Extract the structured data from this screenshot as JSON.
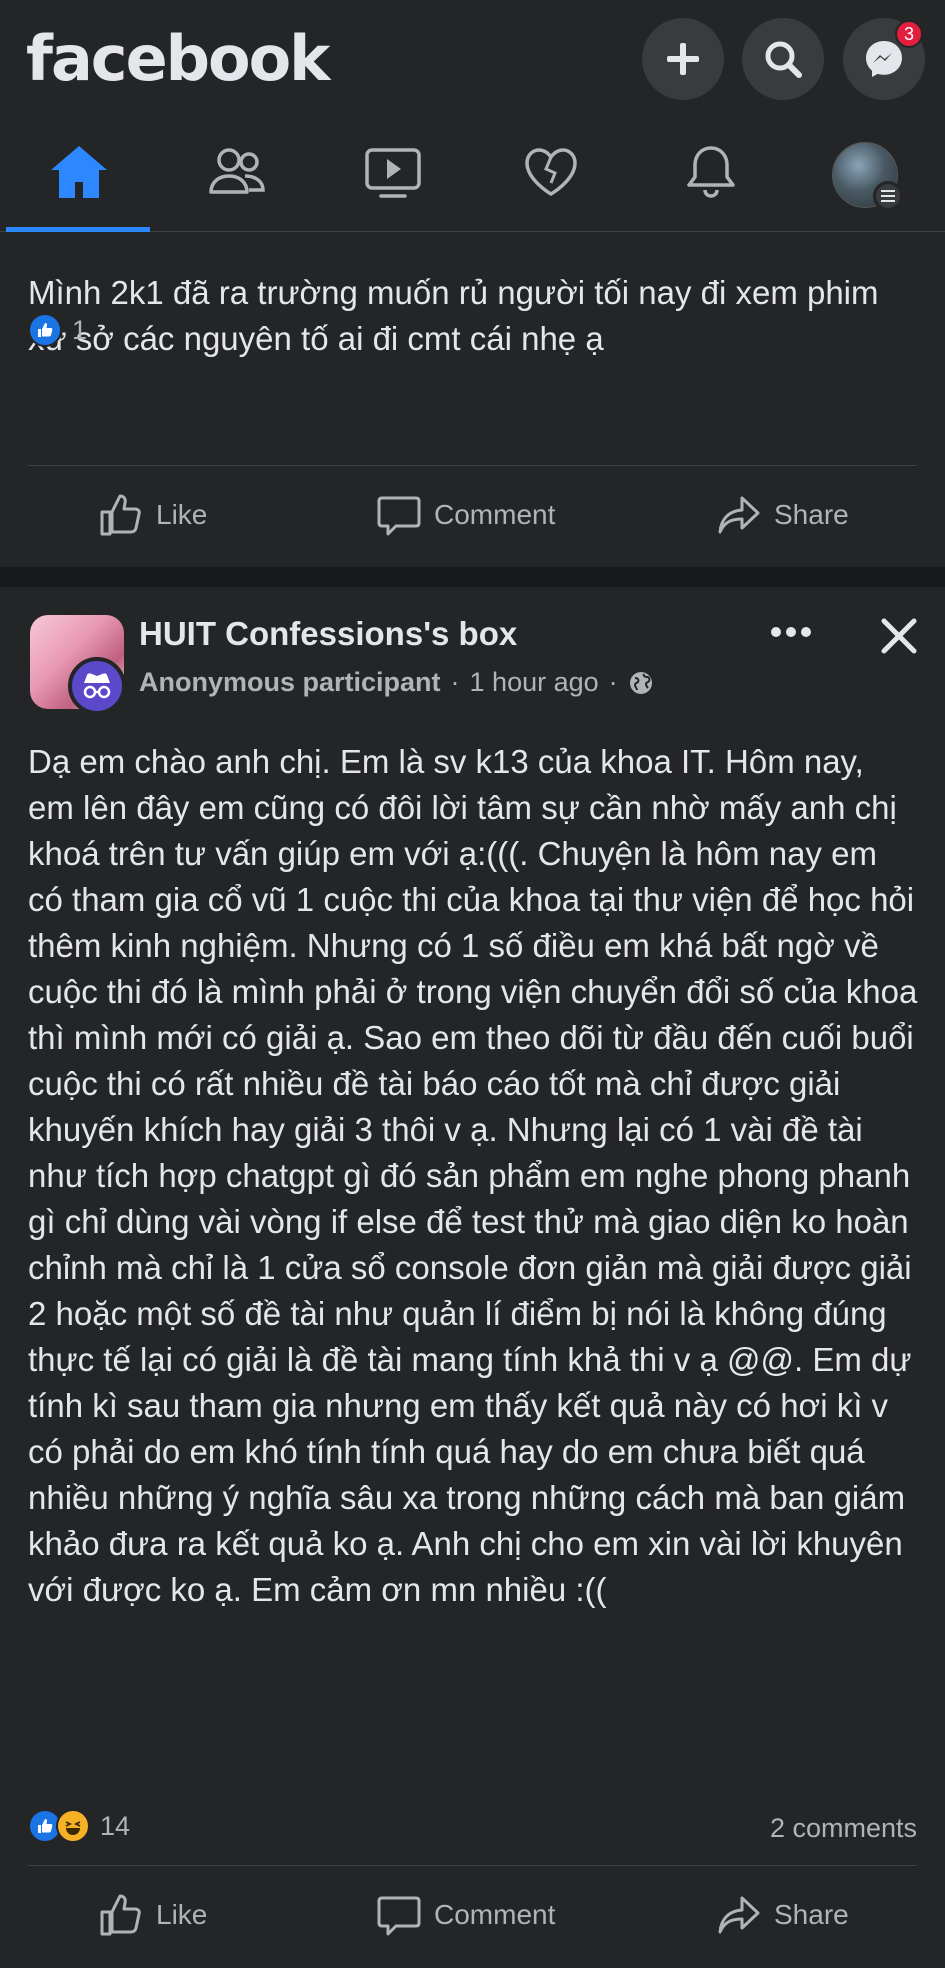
{
  "header": {
    "logo": "facebook",
    "messenger_badge": "3"
  },
  "nav": {
    "items": [
      "home",
      "friends",
      "watch",
      "dating",
      "notifications",
      "profile-menu"
    ],
    "active": "home"
  },
  "post1": {
    "text": "Mình 2k1 đã ra trường muốn rủ người tối nay đi xem phim xử sở các nguyên tố ai đi cmt cái nhẹ ạ",
    "reaction_count": "1",
    "actions": {
      "like": "Like",
      "comment": "Comment",
      "share": "Share"
    }
  },
  "post2": {
    "page_name": "HUIT Confessions's box",
    "author": "Anonymous participant",
    "time": "1 hour ago",
    "separator": "·",
    "text": "Dạ em chào anh chị. Em là sv k13 của khoa IT. Hôm nay, em lên đây em cũng có đôi lời tâm sự cần nhờ mấy anh chị khoá trên tư vấn giúp em với ạ:(((. Chuyện là hôm nay em có tham gia cổ vũ 1 cuộc thi của khoa tại thư viện để học hỏi thêm kinh nghiệm. Nhưng có 1 số điều em khá bất ngờ về cuộc thi đó là mình phải ở trong viện chuyển đổi số của khoa thì mình mới có giải ạ. Sao em theo dõi từ đầu đến cuối buổi cuộc thi có rất nhiều đề tài báo cáo tốt mà chỉ được giải khuyến khích hay giải 3 thôi v ạ. Nhưng lại có 1 vài đề tài như tích hợp chatgpt gì đó sản phẩm em nghe phong phanh gì chỉ dùng vài vòng if else để test thử mà giao diện ko hoàn chỉnh mà chỉ là 1 cửa sổ console đơn giản mà giải được giải 2 hoặc một số đề tài như quản lí điểm bị nói là không đúng thực tế lại có giải là đề tài mang tính khả thi v ạ @@. Em dự tính kì sau tham gia nhưng em thấy kết quả này có hơi kì v có phải do em khó tính tính quá hay do em chưa biết quá nhiều những ý nghĩa sâu xa trong những cách mà ban giám khảo đưa ra kết quả ko ạ. Anh chị cho em xin vài lời khuyên với được ko ạ. Em cảm ơn mn nhiều :((",
    "reaction_count": "14",
    "comments": "2 comments",
    "actions": {
      "like": "Like",
      "comment": "Comment",
      "share": "Share"
    }
  },
  "colors": {
    "background": "#242526",
    "separator": "#18191a",
    "accent": "#2d88ff",
    "text": "#e4e6eb",
    "muted": "#b0b3b8",
    "badge": "#e41e3f"
  }
}
